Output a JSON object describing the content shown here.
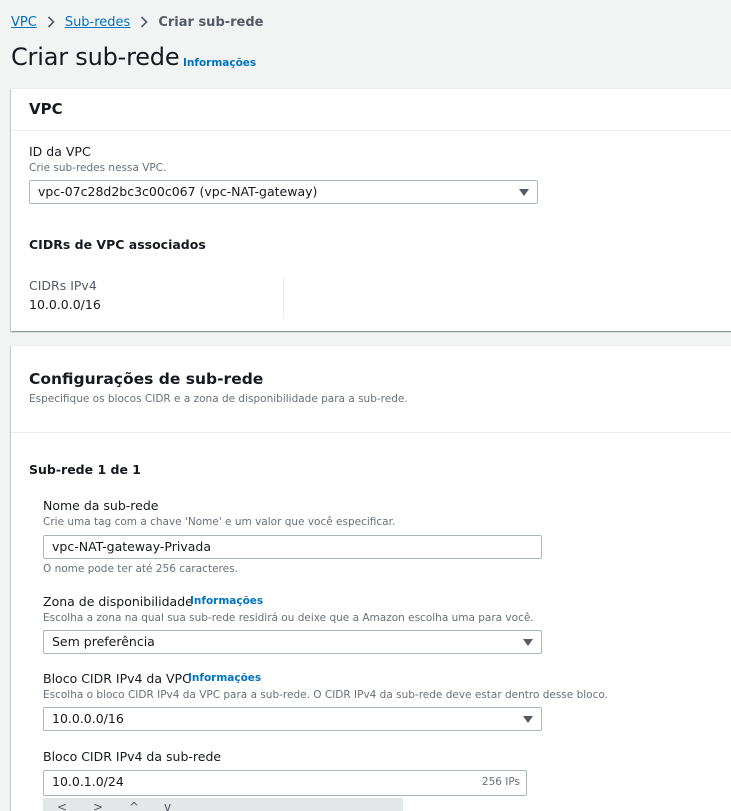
{
  "breadcrumb": {
    "items": [
      "VPC",
      "Sub-redes"
    ],
    "current": "Criar sub-rede"
  },
  "page": {
    "title": "Criar sub-rede",
    "info_link": "Informações"
  },
  "vpc_panel": {
    "title": "VPC",
    "vpc_id_label": "ID da VPC",
    "vpc_id_desc": "Crie sub-redes nessa VPC.",
    "vpc_id_value": "vpc-07c28d2bc3c00c067 (vpc-NAT-gateway)",
    "cidrs_heading": "CIDRs de VPC associados",
    "ipv4_label": "CIDRs IPv4",
    "ipv4_value": "10.0.0.0/16"
  },
  "config_panel": {
    "title": "Configurações de sub-rede",
    "desc": "Especifique os blocos CIDR e a zona de disponibilidade para a sub-rede.",
    "subnet_counter": "Sub-rede 1 de 1",
    "name_label": "Nome da sub-rede",
    "name_desc": "Crie uma tag com a chave 'Nome' e um valor que você especificar.",
    "name_value": "vpc-NAT-gateway-Privada",
    "name_hint": "O nome pode ter até 256 caracteres.",
    "az_label": "Zona de disponibilidade",
    "az_info": "Informações",
    "az_desc": "Escolha a zona na qual sua sub-rede residirá ou deixe que a Amazon escolha uma para você.",
    "az_value": "Sem preferência",
    "vpc_cidr_label": "Bloco CIDR IPv4 da VPC",
    "vpc_cidr_info": "Informações",
    "vpc_cidr_desc": "Escolha o bloco CIDR IPv4 da VPC para a sub-rede. O CIDR IPv4 da sub-rede deve estar dentro desse bloco.",
    "vpc_cidr_value": "10.0.0.0/16",
    "subnet_cidr_label": "Bloco CIDR IPv4 da sub-rede",
    "subnet_cidr_value": "10.0.1.0/24",
    "subnet_cidr_suffix": "256 IPs"
  },
  "colors": {
    "link": "#0073bb",
    "background": "#f2f3f3",
    "text": "#16191f",
    "muted": "#687078"
  }
}
